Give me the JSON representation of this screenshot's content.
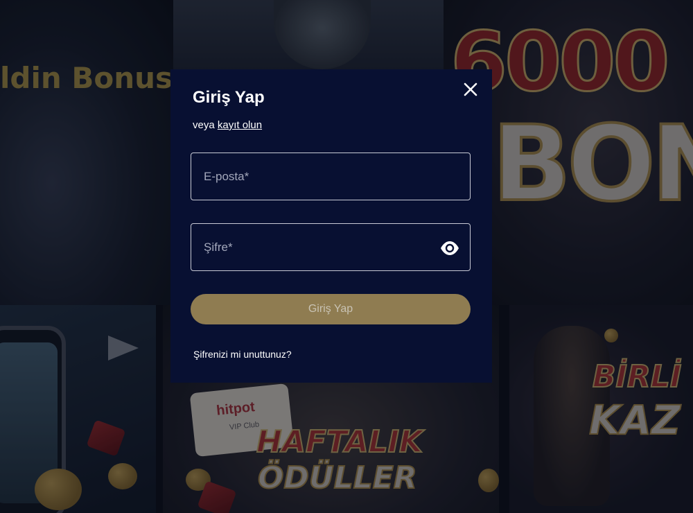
{
  "background": {
    "bonus_headline": "ldin Bonusu",
    "big_amount": "6000",
    "big_bonus": "BONU",
    "weekly_line1": "HAFTALIK",
    "weekly_line2": "ÖDÜLLER",
    "together_line1": "BİRLİ",
    "together_line2": "KAZ",
    "vip_logo": "hitpot",
    "vip_sub": "VIP Club"
  },
  "modal": {
    "title": "Giriş Yap",
    "register_prefix": "veya ",
    "register_link": "kayıt olun",
    "email": {
      "value": "",
      "placeholder": "E-posta*"
    },
    "password": {
      "value": "",
      "placeholder": "Şifre*"
    },
    "submit_label": "Giriş Yap",
    "forgot_label": "Şifrenizi mi unuttunuz?"
  },
  "icons": {
    "close": "close-icon",
    "toggle_password": "eye-icon"
  },
  "colors": {
    "modal_bg": "#081032",
    "submit_bg": "#8f7c51",
    "field_border": "#c9cbd6"
  }
}
